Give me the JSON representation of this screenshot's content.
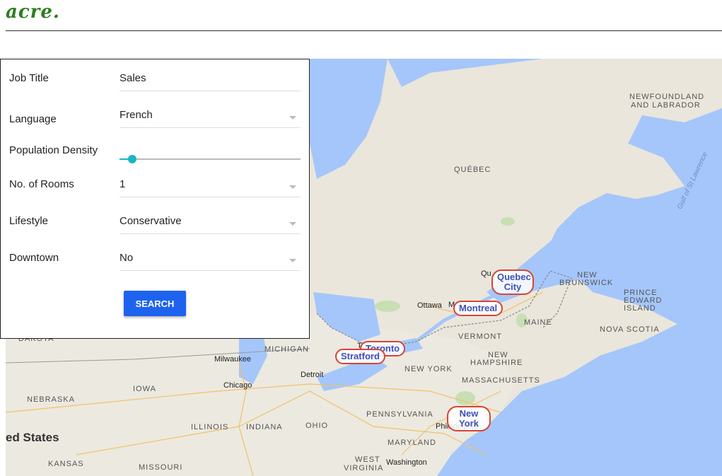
{
  "app": {
    "logo": "acre."
  },
  "form": {
    "job_title": {
      "label": "Job Title",
      "value": "Sales"
    },
    "language": {
      "label": "Language",
      "value": "French"
    },
    "population_density": {
      "label": "Population Density",
      "value": 0.07
    },
    "rooms": {
      "label": "No. of Rooms",
      "value": "1"
    },
    "lifestyle": {
      "label": "Lifestyle",
      "value": "Conservative"
    },
    "downtown": {
      "label": "Downtown",
      "value": "No"
    },
    "search_label": "SEARCH"
  },
  "map": {
    "markers": [
      "Quebec City",
      "Montreal",
      "Toronto",
      "Stratford",
      "New York"
    ],
    "regions": [
      "NEWFOUNDLAND",
      "AND LABRADOR",
      "QUÉBEC",
      "NEW",
      "BRUNSWICK",
      "PRINCE",
      "EDWARD",
      "ISLAND",
      "NOVA SCOTIA",
      "MAINE",
      "VERMONT",
      "NEW",
      "HAMPSHIRE",
      "MASSACHUSETTS",
      "NEW YORK",
      "PENNSYLVANIA",
      "MICHIGAN",
      "IOWA",
      "NEBRASKA",
      "ILLINOIS",
      "INDIANA",
      "OHIO",
      "MARYLAND",
      "WEST",
      "VIRGINIA",
      "KANSAS",
      "MISSOURI",
      "DAKOTA"
    ],
    "cities": [
      "Ottawa",
      "Milwaukee",
      "Chicago",
      "Detroit",
      "Philadelphia",
      "Washington",
      "Qu",
      "M",
      "T"
    ],
    "country": "ed States",
    "water": "Gulf of St Lawrence"
  }
}
